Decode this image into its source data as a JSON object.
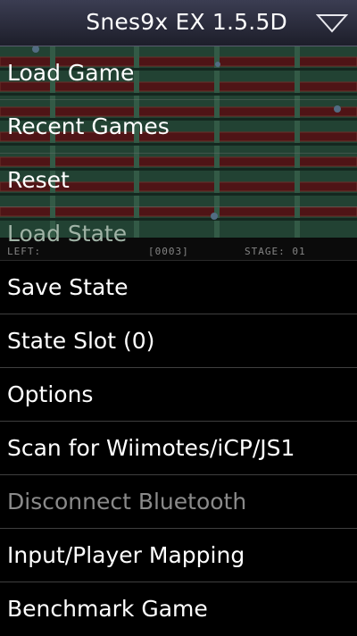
{
  "app": {
    "title": "Snes9x EX 1.5.5D",
    "menu_icon": "dropdown-triangle-icon"
  },
  "game_status": {
    "left": "LEFT:",
    "counter": "[0003]",
    "stage": "STAGE: 01"
  },
  "menu": {
    "items": [
      {
        "label": "Load Game",
        "enabled": true
      },
      {
        "label": "Recent Games",
        "enabled": true
      },
      {
        "label": "Reset",
        "enabled": true
      },
      {
        "label": "Load State",
        "enabled": false
      },
      {
        "label": "Save State",
        "enabled": true
      },
      {
        "label": "State Slot (0)",
        "enabled": true
      },
      {
        "label": "Options",
        "enabled": true
      },
      {
        "label": "Scan for Wiimotes/iCP/JS1",
        "enabled": true
      },
      {
        "label": "Disconnect Bluetooth",
        "enabled": false
      },
      {
        "label": "Input/Player Mapping",
        "enabled": true
      },
      {
        "label": "Benchmark Game",
        "enabled": true
      }
    ]
  },
  "colors": {
    "titlebar_top": "#3b3d52",
    "titlebar_bottom": "#1d1e2a",
    "game_green": "#3a6a52",
    "brick_red": "#7a1f22",
    "disabled_text": "#8a8a8a"
  }
}
